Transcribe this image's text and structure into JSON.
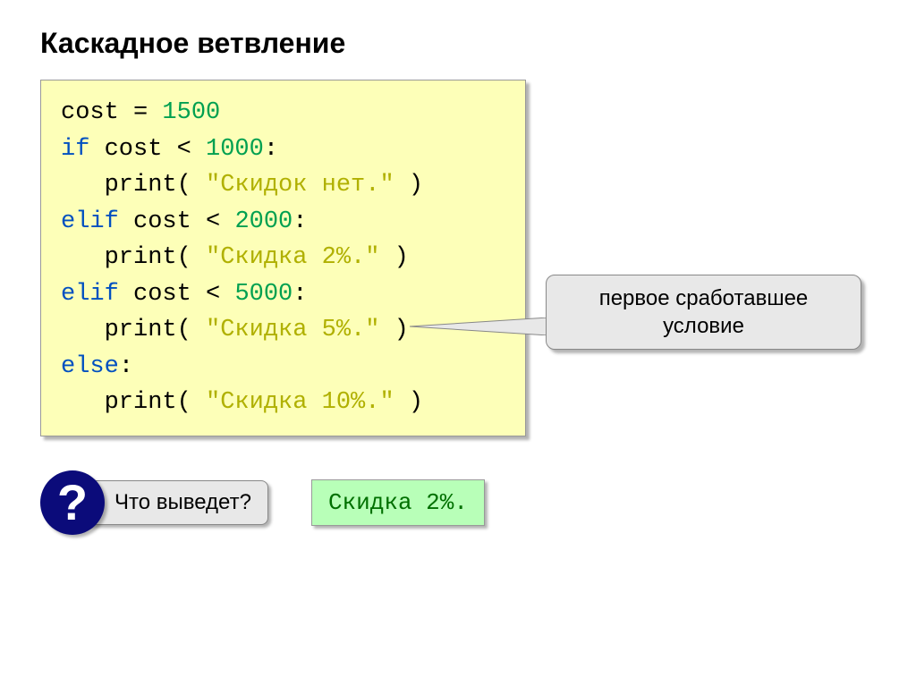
{
  "title": "Каскадное ветвление",
  "code": {
    "l1_var": "cost",
    "l1_eq": " = ",
    "l1_val": "1500",
    "l2_kw": "if",
    "l2_expr": " cost < ",
    "l2_val": "1000",
    "l2_colon": ":",
    "l3_fn": "print",
    "l3_open": "( ",
    "l3_str": "\"Скидок нет.\"",
    "l3_close": " )",
    "l4_kw": "elif",
    "l4_expr": " cost < ",
    "l4_val": "2000",
    "l4_colon": ":",
    "l5_fn": "print",
    "l5_open": "( ",
    "l5_str": "\"Скидка 2%.\"",
    "l5_close": " )",
    "l6_kw": "elif",
    "l6_expr": " cost < ",
    "l6_val": "5000",
    "l6_colon": ":",
    "l7_fn": "print",
    "l7_open": "( ",
    "l7_str": "\"Скидка 5%.\"",
    "l7_close": " )",
    "l8_kw": "else",
    "l8_colon": ":",
    "l9_fn": "print",
    "l9_open": "( ",
    "l9_str": "\"Скидка 10%.\"",
    "l9_close": " )"
  },
  "callout": "первое сработавшее условие",
  "qmark": "?",
  "question": "Что выведет?",
  "answer": "Скидка 2%."
}
